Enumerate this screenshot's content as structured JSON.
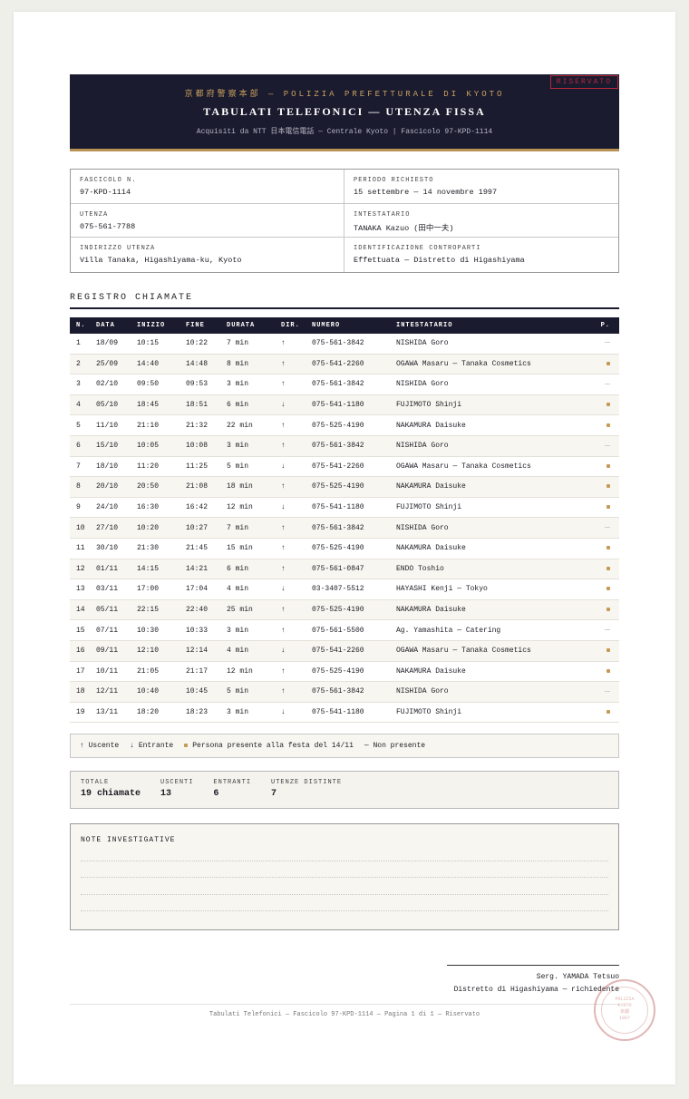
{
  "header": {
    "agency": "京都府警察本部 — POLIZIA PREFETTURALE DI KYOTO",
    "title": "TABULATI TELEFONICI — UTENZA FISSA",
    "subtitle": "Acquisiti da NTT 日本電信電話 — Centrale Kyoto  |  Fascicolo 97-KPD-1114",
    "badge": "RISERVATO"
  },
  "info": {
    "fascicolo_label": "FASCICOLO N.",
    "fascicolo_value": "97-KPD-1114",
    "periodo_label": "PERIODO RICHIESTO",
    "periodo_value": "15 settembre — 14 novembre 1997",
    "utenza_label": "UTENZA",
    "utenza_value": "075-561-7788",
    "intestatario_label": "INTESTATARIO",
    "intestatario_value": "TANAKA Kazuo (田中一夫)",
    "indirizzo_label": "INDIRIZZO UTENZA",
    "indirizzo_value": "Villa Tanaka, Higashiyama-ku, Kyoto",
    "controparti_label": "IDENTIFICAZIONE CONTROPARTI",
    "controparti_value": "Effettuata — Distretto di Higashiyama"
  },
  "registro": {
    "title": "REGISTRO CHIAMATE",
    "columns": [
      "N.",
      "DATA",
      "INIZIO",
      "FINE",
      "DURATA",
      "DIR.",
      "NUMERO",
      "INTESTATARIO",
      "P."
    ],
    "rows": [
      {
        "n": "1",
        "data": "18/09",
        "inizio": "10:15",
        "fine": "10:22",
        "durata": "7 min",
        "dir": "↑",
        "numero": "075-561-3842",
        "intestatario": "NISHIDA Goro",
        "presente": false
      },
      {
        "n": "2",
        "data": "25/09",
        "inizio": "14:40",
        "fine": "14:48",
        "durata": "8 min",
        "dir": "↑",
        "numero": "075-541-2260",
        "intestatario": "OGAWA Masaru — Tanaka Cosmetics",
        "presente": true
      },
      {
        "n": "3",
        "data": "02/10",
        "inizio": "09:50",
        "fine": "09:53",
        "durata": "3 min",
        "dir": "↑",
        "numero": "075-561-3842",
        "intestatario": "NISHIDA Goro",
        "presente": false
      },
      {
        "n": "4",
        "data": "05/10",
        "inizio": "18:45",
        "fine": "18:51",
        "durata": "6 min",
        "dir": "↓",
        "numero": "075-541-1180",
        "intestatario": "FUJIMOTO Shinji",
        "presente": true
      },
      {
        "n": "5",
        "data": "11/10",
        "inizio": "21:10",
        "fine": "21:32",
        "durata": "22 min",
        "dir": "↑",
        "numero": "075-525-4190",
        "intestatario": "NAKAMURA Daisuke",
        "presente": true
      },
      {
        "n": "6",
        "data": "15/10",
        "inizio": "10:05",
        "fine": "10:08",
        "durata": "3 min",
        "dir": "↑",
        "numero": "075-561-3842",
        "intestatario": "NISHIDA Goro",
        "presente": false
      },
      {
        "n": "7",
        "data": "18/10",
        "inizio": "11:20",
        "fine": "11:25",
        "durata": "5 min",
        "dir": "↓",
        "numero": "075-541-2260",
        "intestatario": "OGAWA Masaru — Tanaka Cosmetics",
        "presente": true
      },
      {
        "n": "8",
        "data": "20/10",
        "inizio": "20:50",
        "fine": "21:08",
        "durata": "18 min",
        "dir": "↑",
        "numero": "075-525-4190",
        "intestatario": "NAKAMURA Daisuke",
        "presente": true
      },
      {
        "n": "9",
        "data": "24/10",
        "inizio": "16:30",
        "fine": "16:42",
        "durata": "12 min",
        "dir": "↓",
        "numero": "075-541-1180",
        "intestatario": "FUJIMOTO Shinji",
        "presente": true
      },
      {
        "n": "10",
        "data": "27/10",
        "inizio": "10:20",
        "fine": "10:27",
        "durata": "7 min",
        "dir": "↑",
        "numero": "075-561-3842",
        "intestatario": "NISHIDA Goro",
        "presente": false
      },
      {
        "n": "11",
        "data": "30/10",
        "inizio": "21:30",
        "fine": "21:45",
        "durata": "15 min",
        "dir": "↑",
        "numero": "075-525-4190",
        "intestatario": "NAKAMURA Daisuke",
        "presente": true
      },
      {
        "n": "12",
        "data": "01/11",
        "inizio": "14:15",
        "fine": "14:21",
        "durata": "6 min",
        "dir": "↑",
        "numero": "075-561-0847",
        "intestatario": "ENDO Toshio",
        "presente": true
      },
      {
        "n": "13",
        "data": "03/11",
        "inizio": "17:00",
        "fine": "17:04",
        "durata": "4 min",
        "dir": "↓",
        "numero": "03-3407-5512",
        "intestatario": "HAYASHI Kenji — Tokyo",
        "presente": true
      },
      {
        "n": "14",
        "data": "05/11",
        "inizio": "22:15",
        "fine": "22:40",
        "durata": "25 min",
        "dir": "↑",
        "numero": "075-525-4190",
        "intestatario": "NAKAMURA Daisuke",
        "presente": true
      },
      {
        "n": "15",
        "data": "07/11",
        "inizio": "10:30",
        "fine": "10:33",
        "durata": "3 min",
        "dir": "↑",
        "numero": "075-561-5500",
        "intestatario": "Ag. Yamashita — Catering",
        "presente": false
      },
      {
        "n": "16",
        "data": "09/11",
        "inizio": "12:10",
        "fine": "12:14",
        "durata": "4 min",
        "dir": "↓",
        "numero": "075-541-2260",
        "intestatario": "OGAWA Masaru — Tanaka Cosmetics",
        "presente": true
      },
      {
        "n": "17",
        "data": "10/11",
        "inizio": "21:05",
        "fine": "21:17",
        "durata": "12 min",
        "dir": "↑",
        "numero": "075-525-4190",
        "intestatario": "NAKAMURA Daisuke",
        "presente": true
      },
      {
        "n": "18",
        "data": "12/11",
        "inizio": "10:40",
        "fine": "10:45",
        "durata": "5 min",
        "dir": "↑",
        "numero": "075-561-3842",
        "intestatario": "NISHIDA Goro",
        "presente": false
      },
      {
        "n": "19",
        "data": "13/11",
        "inizio": "18:20",
        "fine": "18:23",
        "durata": "3 min",
        "dir": "↓",
        "numero": "075-541-1180",
        "intestatario": "FUJIMOTO Shinji",
        "presente": true
      }
    ]
  },
  "legend": {
    "uscente": "↑ Uscente",
    "entrante": "↓ Entrante",
    "presente": "Persona presente alla festa del 14/11",
    "non_presente": "— Non presente"
  },
  "totals": {
    "totale_label": "TOTALE",
    "totale_value": "19 chiamate",
    "uscenti_label": "USCENTI",
    "uscenti_value": "13",
    "entranti_label": "ENTRANTI",
    "entranti_value": "6",
    "distinte_label": "UTENZE DISTINTE",
    "distinte_value": "7"
  },
  "notes": {
    "title": "NOTE INVESTIGATIVE"
  },
  "signature": {
    "name": "Serg. YAMADA Tetsuo",
    "role": "Distretto di Higashiyama — richiedente"
  },
  "footer": "Tabulati Telefonici — Fascicolo 97-KPD-1114 — Pagina 1 di 1 — Riservato",
  "stamp": {
    "line1": "POLIZIA",
    "line2": "KYOTO",
    "line3": "京都",
    "line4": "1997"
  },
  "colors": {
    "navy": "#1b1b2f",
    "gold": "#c69a55",
    "red": "#b3273a"
  }
}
